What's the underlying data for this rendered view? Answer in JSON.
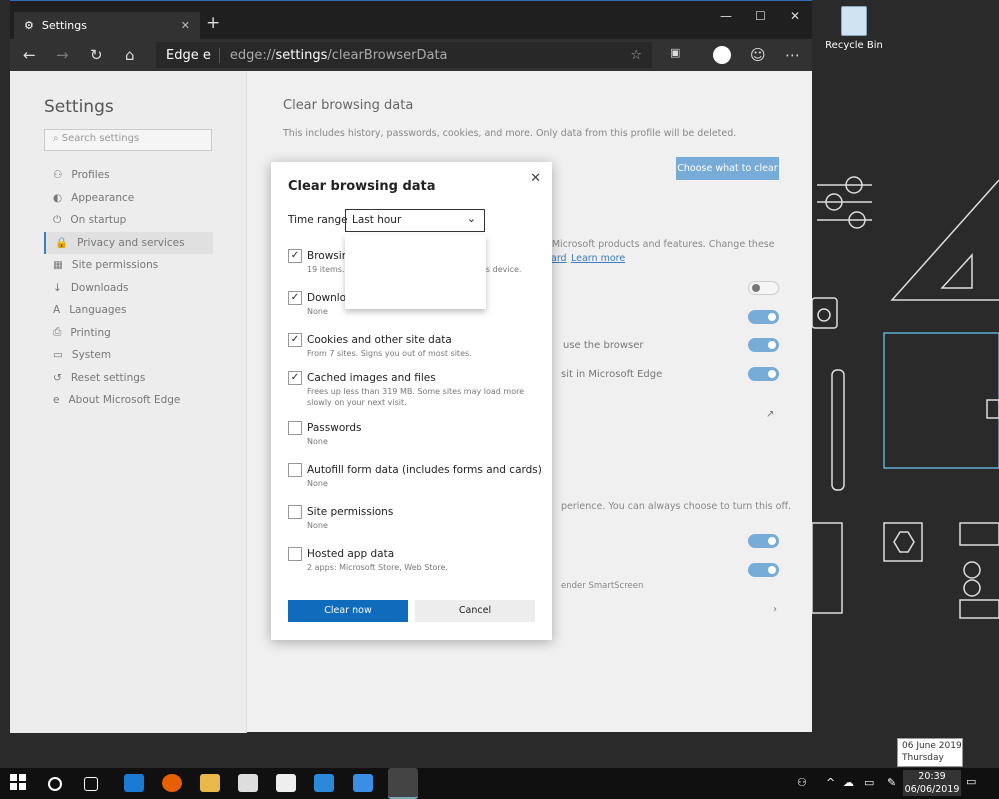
{
  "desktop": {
    "recycle_bin": "Recycle Bin"
  },
  "browser": {
    "tab_title": "Settings",
    "address_brand": "Edge",
    "address_scheme": "edge://",
    "address_host": "settings",
    "address_path": "/clearBrowserData"
  },
  "sidebar": {
    "title": "Settings",
    "search_placeholder": "Search settings",
    "items": [
      {
        "label": "Profiles",
        "icon": "person"
      },
      {
        "label": "Appearance",
        "icon": "palette"
      },
      {
        "label": "On startup",
        "icon": "power"
      },
      {
        "label": "Privacy and services",
        "icon": "lock",
        "selected": true
      },
      {
        "label": "Site permissions",
        "icon": "grid"
      },
      {
        "label": "Downloads",
        "icon": "download"
      },
      {
        "label": "Languages",
        "icon": "language"
      },
      {
        "label": "Printing",
        "icon": "printer"
      },
      {
        "label": "System",
        "icon": "laptop"
      },
      {
        "label": "Reset settings",
        "icon": "reset"
      },
      {
        "label": "About Microsoft Edge",
        "icon": "edge"
      }
    ]
  },
  "main": {
    "title": "Clear browsing data",
    "desc": "This includes history, passwords, cookies, and more. Only data from this profile will be deleted.",
    "choose_button": "Choose what to clear",
    "fragments": {
      "products": "e Microsoft products and features. Change these",
      "dashboard": "ard",
      "learn_more": "Learn more",
      "use_browser": "use the browser",
      "visit_edge": "sit in Microsoft Edge",
      "experience": "perience. You can always choose to turn this off.",
      "smartscreen": "ender SmartScreen"
    },
    "toggles": [
      false,
      true,
      true,
      true,
      true,
      true
    ]
  },
  "dialog": {
    "title": "Clear browsing data",
    "time_range_label": "Time range",
    "time_range_value": "Last hour",
    "items": [
      {
        "label": "Browsing history",
        "sub": "19 items. Browsing data is only stored on this device.",
        "checked": true
      },
      {
        "label": "Download history",
        "sub": "None",
        "checked": true
      },
      {
        "label": "Cookies and other site data",
        "sub": "From 7 sites. Signs you out of most sites.",
        "checked": true
      },
      {
        "label": "Cached images and files",
        "sub": "Frees up less than 319 MB. Some sites may load more slowly on your next visit.",
        "checked": true
      },
      {
        "label": "Passwords",
        "sub": "None",
        "checked": false
      },
      {
        "label": "Autofill form data (includes forms and cards)",
        "sub": "None",
        "checked": false
      },
      {
        "label": "Site permissions",
        "sub": "None",
        "checked": false
      },
      {
        "label": "Hosted app data",
        "sub": "2 apps: Microsoft Store, Web Store.",
        "checked": false
      }
    ],
    "clear_button": "Clear now",
    "cancel_button": "Cancel"
  },
  "taskbar": {
    "time": "20:39",
    "date": "06/06/2019",
    "tooltip_date": "06 June 2019",
    "tooltip_day": "Thursday"
  },
  "colors": {
    "accent": "#0f6cbd",
    "toggle_on": "#78acd8"
  }
}
